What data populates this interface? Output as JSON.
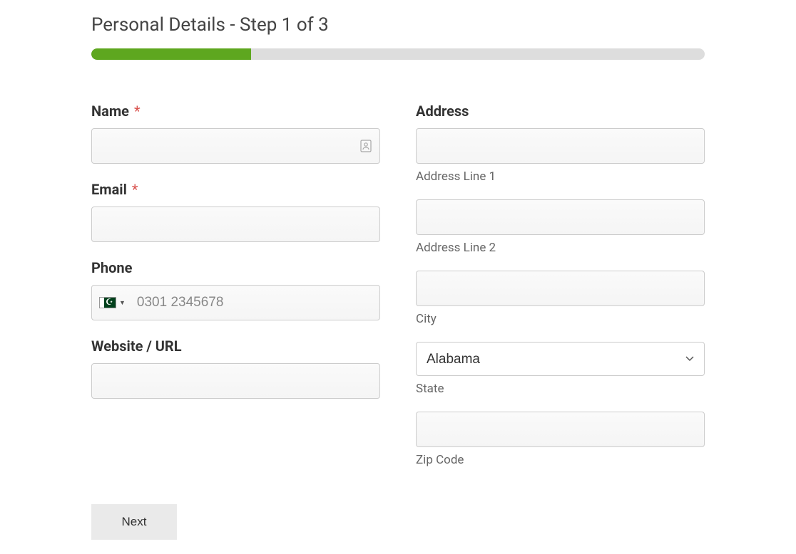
{
  "header": {
    "title": "Personal Details - Step 1 of 3"
  },
  "progress": {
    "percent": 26
  },
  "left_col": {
    "name": {
      "label": "Name",
      "required_marker": "*",
      "value": ""
    },
    "email": {
      "label": "Email",
      "required_marker": "*",
      "value": ""
    },
    "phone": {
      "label": "Phone",
      "placeholder": "0301 2345678",
      "value": "",
      "country_code": "PK"
    },
    "website": {
      "label": "Website / URL",
      "value": ""
    }
  },
  "right_col": {
    "address": {
      "label": "Address",
      "line1": {
        "sublabel": "Address Line 1",
        "value": ""
      },
      "line2": {
        "sublabel": "Address Line 2",
        "value": ""
      },
      "city": {
        "sublabel": "City",
        "value": ""
      },
      "state": {
        "sublabel": "State",
        "selected": "Alabama",
        "options": [
          "Alabama"
        ]
      },
      "zip": {
        "sublabel": "Zip Code",
        "value": ""
      }
    }
  },
  "actions": {
    "next_label": "Next"
  },
  "colors": {
    "progress_fill": "#5ea71f",
    "progress_track": "#dddddd",
    "required": "#d9534f"
  }
}
